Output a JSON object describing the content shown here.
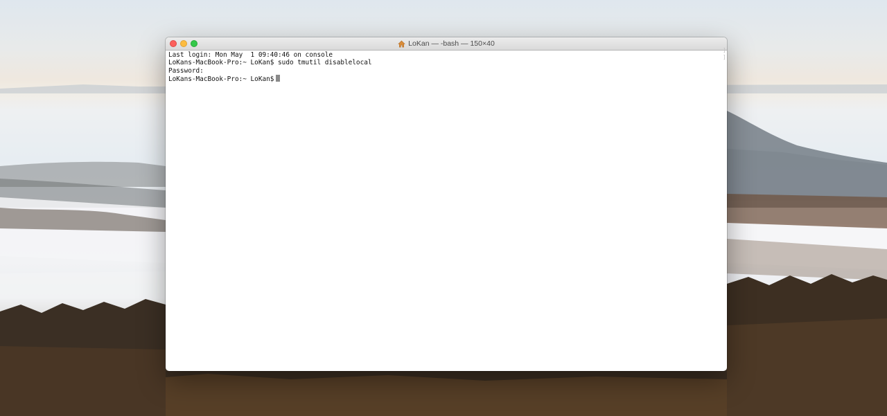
{
  "window": {
    "title": "LoKan — -bash — 150×40",
    "title_icon": "home-icon"
  },
  "terminal": {
    "lines": [
      "Last login: Mon May  1 09:40:46 on console",
      "LoKans-MacBook-Pro:~ LoKan$ sudo tmutil disablelocal",
      "Password:",
      "LoKans-MacBook-Pro:~ LoKan$"
    ]
  },
  "colors": {
    "close": "#fc605c",
    "minimize": "#fdbc40",
    "maximize": "#34c84a",
    "terminal_background": "#ffffff",
    "terminal_text": "#111111",
    "cursor": "#8a8a8a"
  }
}
